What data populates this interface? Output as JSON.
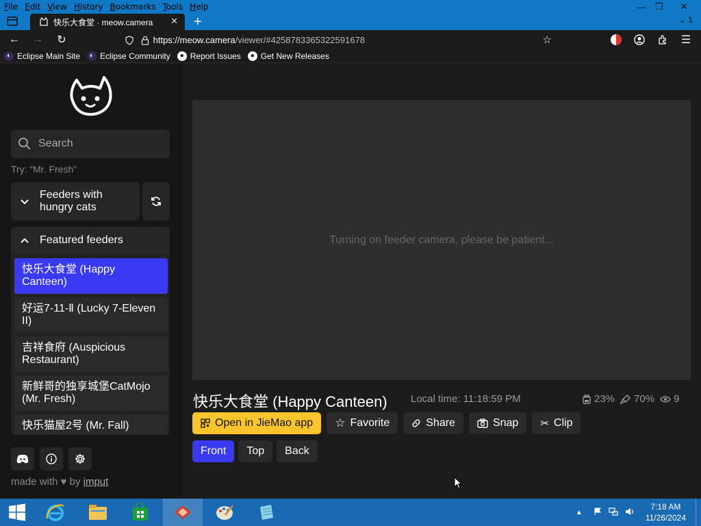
{
  "menu": [
    "File",
    "Edit",
    "View",
    "History",
    "Bookmarks",
    "Tools",
    "Help"
  ],
  "window_controls": {
    "minimize": "—",
    "restore": "❐",
    "close": "✕"
  },
  "tab": {
    "title": "快乐大食堂 · meow.camera",
    "tab_count": "1"
  },
  "nav": {
    "url_host": "https://meow.camera",
    "url_path": "/viewer/#4258783365322591678"
  },
  "bookmarks": [
    "Eclipse Main Site",
    "Eclipse Community",
    "Report Issues",
    "Get New Releases"
  ],
  "sidebar": {
    "search_placeholder": "Search",
    "hint": "Try: “Mr. Fresh”",
    "hungry_section": "Feeders with hungry cats",
    "featured_section": "Featured feeders",
    "feeders": [
      "快乐大食堂 (Happy Canteen)",
      "好运7-11-Ⅱ (Lucky 7-Eleven II)",
      "吉祥食府 (Auspicious Restaurant)",
      "新鲜哥的独享城堡CatMojo (Mr. Fresh)",
      "快乐猫屋2号 (Mr. Fall)"
    ],
    "made_with": "made with",
    "by": "by",
    "author": "imput"
  },
  "viewer": {
    "status": "Turning on feeder camera, please be patient...",
    "feeder_title": "快乐大食堂 (Happy Canteen)",
    "local_time": "Local time: 11:18:59 PM",
    "stats": {
      "food": "23%",
      "cleanliness": "70%",
      "viewers": "9"
    },
    "actions": [
      "Open in JieMao app",
      "Favorite",
      "Share",
      "Snap",
      "Clip"
    ],
    "views": [
      "Front",
      "Top",
      "Back"
    ],
    "active_view": "Front"
  },
  "taskbar": {
    "time": "7:18 AM",
    "date": "11/26/2024"
  }
}
